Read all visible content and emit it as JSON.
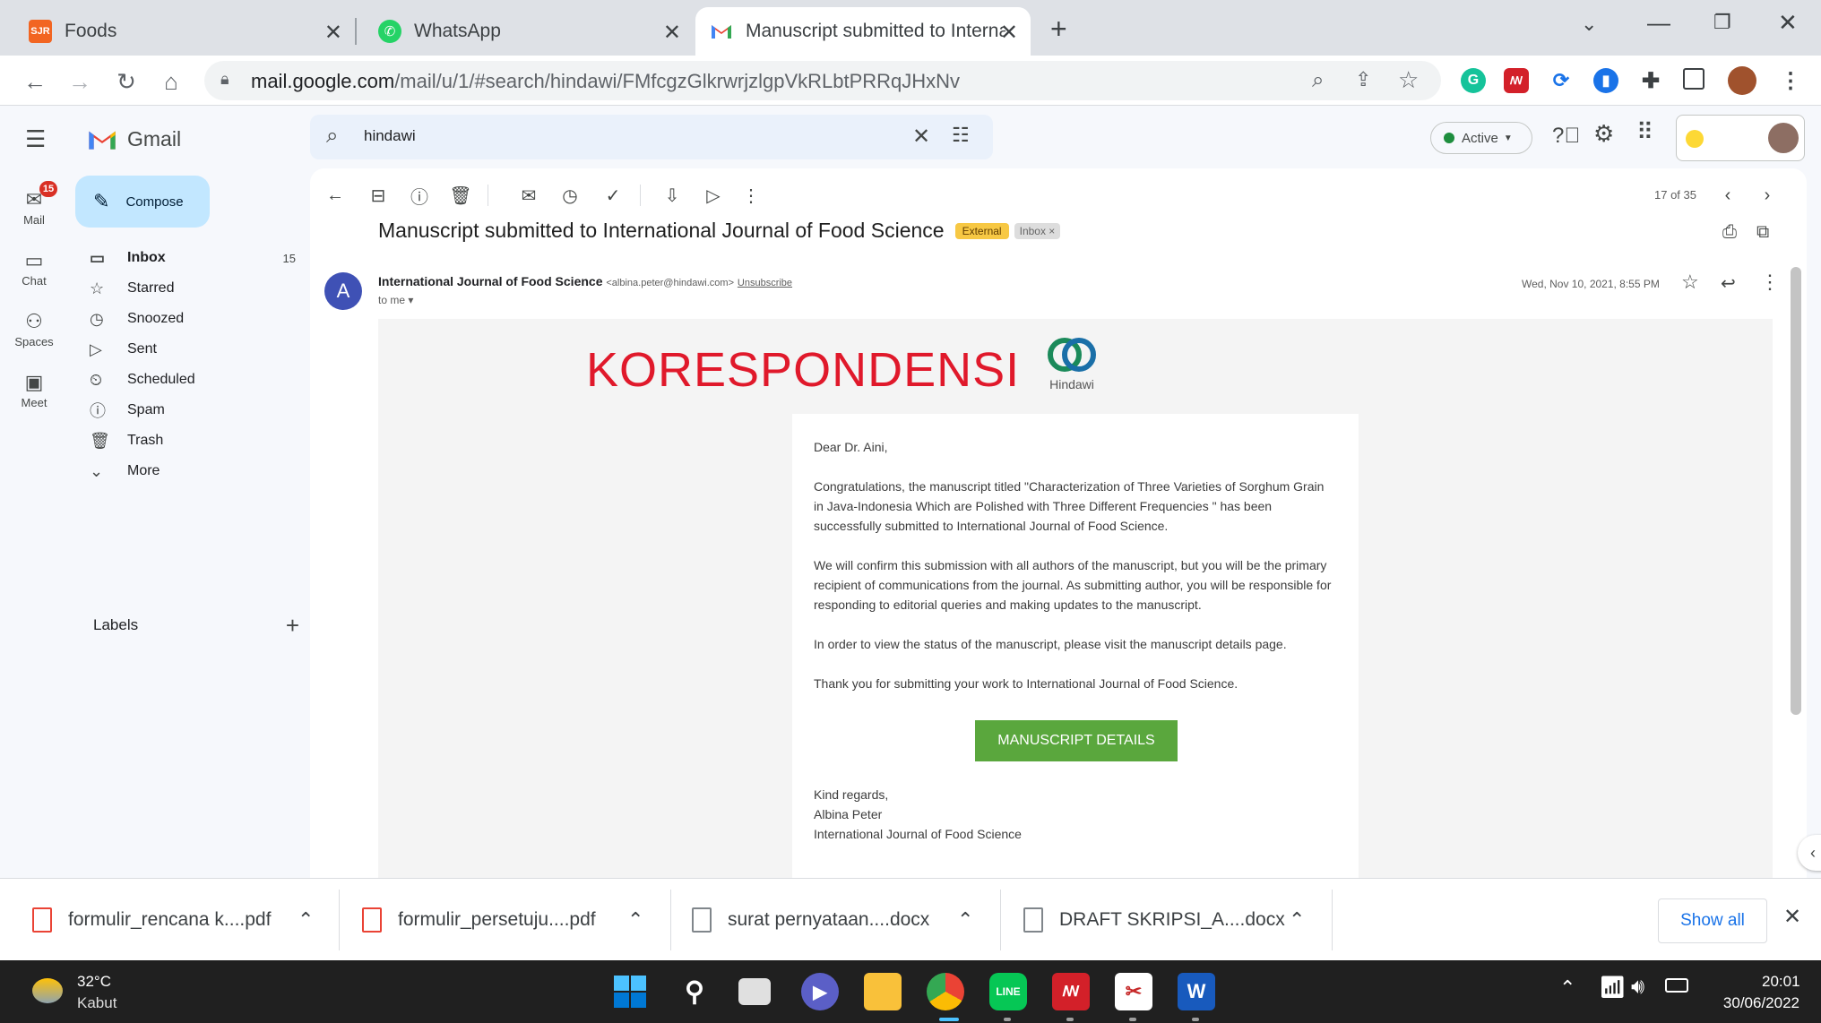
{
  "browser": {
    "tabs": [
      {
        "label": "Foods",
        "favicon": "SJR"
      },
      {
        "label": "WhatsApp",
        "favicon": "whatsapp-icon"
      },
      {
        "label": "Manuscript submitted to Internat",
        "favicon": "gmail-icon"
      }
    ],
    "url_domain": "mail.google.com",
    "url_path": "/mail/u/1/#search/hindawi/FMfcgzGlkrwrjzlgpVkRLbtPRRqJHxNv"
  },
  "gmail": {
    "brand": "Gmail",
    "rail": [
      {
        "label": "Mail",
        "icon": "mail-icon",
        "badge": "15"
      },
      {
        "label": "Chat",
        "icon": "chat-icon"
      },
      {
        "label": "Spaces",
        "icon": "spaces-icon"
      },
      {
        "label": "Meet",
        "icon": "meet-icon"
      }
    ],
    "compose": "Compose",
    "nav": [
      {
        "label": "Inbox",
        "count": "15",
        "icon": "inbox-icon"
      },
      {
        "label": "Starred",
        "icon": "star-icon"
      },
      {
        "label": "Snoozed",
        "icon": "clock-icon"
      },
      {
        "label": "Sent",
        "icon": "send-icon"
      },
      {
        "label": "Scheduled",
        "icon": "scheduled-icon"
      },
      {
        "label": "Spam",
        "icon": "spam-icon"
      },
      {
        "label": "Trash",
        "icon": "trash-icon"
      },
      {
        "label": "More",
        "icon": "chevron-down-icon"
      }
    ],
    "labels_heading": "Labels",
    "search_value": "hindawi",
    "status": "Active",
    "pagination": "17 of 35"
  },
  "email": {
    "subject": "Manuscript submitted to International Journal of Food Science",
    "tag_external": "External",
    "tag_inbox": "Inbox",
    "avatar_letter": "A",
    "sender_name": "International Journal of Food Science",
    "sender_email": "<albina.peter@hindawi.com>",
    "unsubscribe": "Unsubscribe",
    "to": "to me",
    "date": "Wed, Nov 10, 2021, 8:55 PM",
    "overlay_text": "KORESPONDENSI",
    "logo_text": "Hindawi",
    "greeting": "Dear Dr. Aini,",
    "para1": "Congratulations, the manuscript titled \"Characterization of Three Varieties of Sorghum Grain in Java-Indonesia Which are Polished with Three Different Frequencies \" has been successfully submitted to International Journal of Food Science.",
    "para2": "We will confirm this submission with all authors of the manuscript, but you will be the primary recipient of communications from the journal. As submitting author, you will be responsible for responding to editorial queries and making updates to the manuscript.",
    "para3": "In order to view the status of the manuscript, please visit the manuscript details page.",
    "para4": "Thank you for submitting your work to International Journal of Food Science.",
    "button": "MANUSCRIPT DETAILS",
    "sign1": "Kind regards,",
    "sign2": "Albina Peter",
    "sign3": "International Journal of Food Science"
  },
  "downloads": {
    "items": [
      "formulir_rencana k....pdf",
      "formulir_persetuju....pdf",
      "surat pernyataan....docx",
      "DRAFT SKRIPSI_A....docx"
    ],
    "show_all": "Show all"
  },
  "taskbar": {
    "temp": "32°C",
    "weather": "Kabut",
    "time": "20:01",
    "date": "30/06/2022"
  },
  "colors": {
    "accent": "#0b57d0",
    "compose_bg": "#c2e7ff",
    "overlay_red": "#e0192b",
    "button_green": "#5aa73d",
    "external_tag": "#f7c844"
  }
}
